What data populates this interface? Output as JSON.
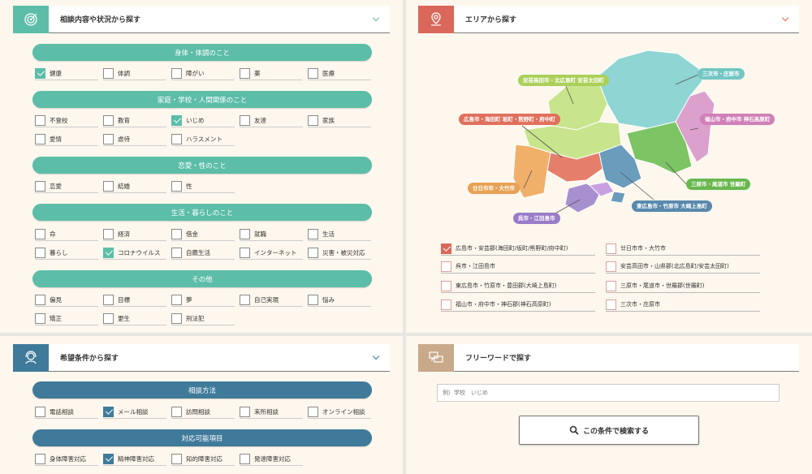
{
  "consult": {
    "title": "相談内容や状況から探す",
    "sections": [
      {
        "label": "身体・体調のこと",
        "items": [
          {
            "label": "健康",
            "checked": true
          },
          {
            "label": "体調",
            "checked": false
          },
          {
            "label": "障がい",
            "checked": false
          },
          {
            "label": "薬",
            "checked": false
          },
          {
            "label": "医療",
            "checked": false
          }
        ]
      },
      {
        "label": "家庭・学校・人間関係のこと",
        "items": [
          {
            "label": "不登校",
            "checked": false
          },
          {
            "label": "教育",
            "checked": false
          },
          {
            "label": "いじめ",
            "checked": true
          },
          {
            "label": "友達",
            "checked": false
          },
          {
            "label": "家族",
            "checked": false
          },
          {
            "label": "愛情",
            "checked": false
          },
          {
            "label": "虐待",
            "checked": false
          },
          {
            "label": "ハラスメント",
            "checked": false
          }
        ]
      },
      {
        "label": "恋愛・性のこと",
        "items": [
          {
            "label": "恋愛",
            "checked": false
          },
          {
            "label": "結婚",
            "checked": false
          },
          {
            "label": "性",
            "checked": false
          }
        ]
      },
      {
        "label": "生活・暮らしのこと",
        "items": [
          {
            "label": "命",
            "checked": false
          },
          {
            "label": "経済",
            "checked": false
          },
          {
            "label": "借金",
            "checked": false
          },
          {
            "label": "就職",
            "checked": false
          },
          {
            "label": "生活",
            "checked": false
          },
          {
            "label": "暮らし",
            "checked": false
          },
          {
            "label": "コロナウイルス",
            "checked": true
          },
          {
            "label": "自薦生活",
            "checked": false
          },
          {
            "label": "インターネット",
            "checked": false
          },
          {
            "label": "災害・被災対応",
            "checked": false
          }
        ]
      },
      {
        "label": "その他",
        "items": [
          {
            "label": "偏見",
            "checked": false
          },
          {
            "label": "目標",
            "checked": false
          },
          {
            "label": "夢",
            "checked": false
          },
          {
            "label": "自己実現",
            "checked": false
          },
          {
            "label": "悩み",
            "checked": false
          },
          {
            "label": "矯正",
            "checked": false
          },
          {
            "label": "更生",
            "checked": false
          },
          {
            "label": "刑法犯",
            "checked": false
          }
        ]
      }
    ]
  },
  "area": {
    "title": "エリアから探す",
    "map_labels": [
      "安芸高田市・北広島町 安芸太田町",
      "三次市・庄原市",
      "広島市・海田町 坂町・熊野町・府中町",
      "福山市・府中市 神石高原町",
      "廿日市市・大竹市",
      "三原市・尾道市 世羅町",
      "東広島市・竹原市 大崎上島町",
      "呉市・江田島市"
    ],
    "checkboxes": [
      {
        "label": "広島市・安芸郡(海田町/坂町/熊野町/府中町)",
        "checked": true
      },
      {
        "label": "廿日市市・大竹市",
        "checked": false
      },
      {
        "label": "呉市・江田島市",
        "checked": false
      },
      {
        "label": "安芸高田市・山県郡(北広島町/安芸太田町)",
        "checked": false
      },
      {
        "label": "東広島市・竹原市・豊田郡(大崎上島町)",
        "checked": false
      },
      {
        "label": "三原市・尾道市・世羅郡(世羅町)",
        "checked": false
      },
      {
        "label": "福山市・府中市・神石郡(神石高原町)",
        "checked": false
      },
      {
        "label": "三次市・庄原市",
        "checked": false
      }
    ]
  },
  "wish": {
    "title": "希望条件から探す",
    "sections": [
      {
        "label": "相談方法",
        "items": [
          {
            "label": "電話相談",
            "checked": false
          },
          {
            "label": "メール相談",
            "checked": true
          },
          {
            "label": "訪問相談",
            "checked": false
          },
          {
            "label": "来所相談",
            "checked": false
          },
          {
            "label": "オンライン相談",
            "checked": false
          }
        ]
      },
      {
        "label": "対応可能項目",
        "items": [
          {
            "label": "身体障害対応",
            "checked": false
          },
          {
            "label": "精神障害対応",
            "checked": true
          },
          {
            "label": "知的障害対応",
            "checked": false
          },
          {
            "label": "発達障害対応",
            "checked": false
          }
        ]
      }
    ]
  },
  "freeword": {
    "title": "フリーワードで探す",
    "placeholder": "例）学校　いじめ",
    "button_label": "この条件で検索する"
  },
  "colors": {
    "teal": "#5cbda8",
    "blue": "#3f7a9a",
    "salmon": "#d9685a",
    "tan": "#c8a98a"
  }
}
